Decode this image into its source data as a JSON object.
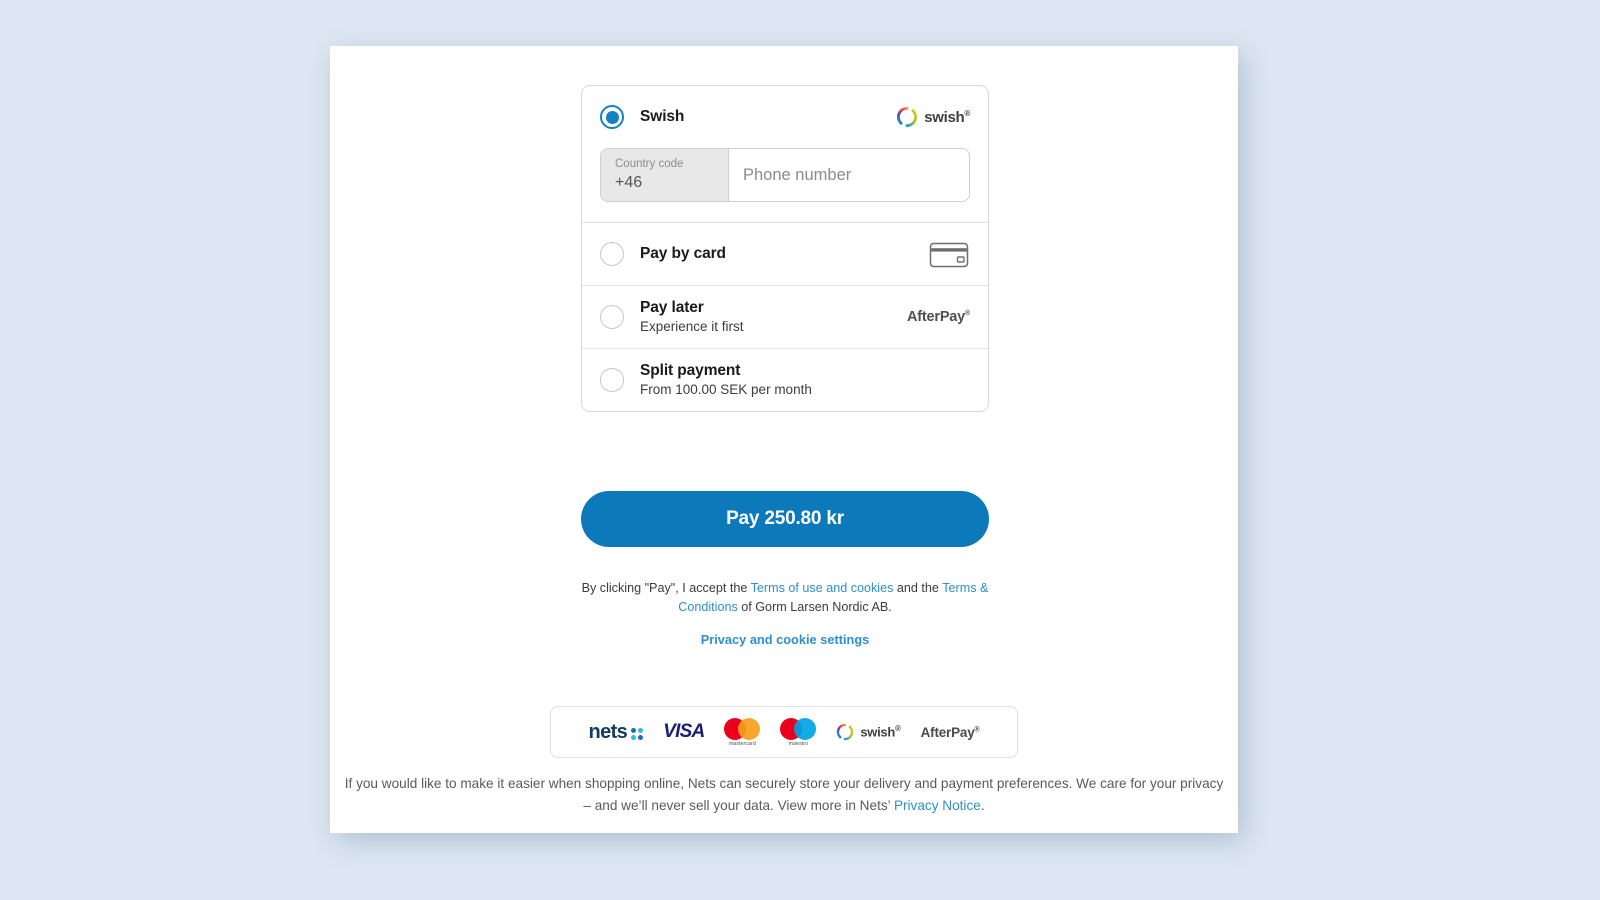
{
  "theme": {
    "background": "#dde7f3",
    "panel": "#ffffff",
    "accent": "#0b79ba",
    "link": "#2f8fcf",
    "radio_selected": "#1680c4",
    "border": "#d8d8d8"
  },
  "methods": [
    {
      "id": "swish",
      "title": "Swish",
      "subtitle": "",
      "selected": true,
      "logo": "swish-logo"
    },
    {
      "id": "card",
      "title": "Pay by card",
      "subtitle": "",
      "selected": false,
      "logo": "credit-card-icon"
    },
    {
      "id": "pay-later",
      "title": "Pay later",
      "subtitle": "Experience it first",
      "selected": false,
      "logo": "afterpay-logo"
    },
    {
      "id": "split-payment",
      "title": "Split payment",
      "subtitle": "From 100.00 SEK per month",
      "selected": false,
      "logo": ""
    }
  ],
  "phone": {
    "country_code_label": "Country code",
    "country_code_value": "+46",
    "number_placeholder": "Phone number"
  },
  "pay": {
    "label": "Pay 250.80 kr",
    "amount": "250.80",
    "currency": "kr"
  },
  "legal": {
    "prefix": "By clicking \"Pay\", I accept the ",
    "link1": "Terms of use and cookies",
    "middle": " and the ",
    "link2": "Terms & Conditions",
    "suffix": " of Gorm Larsen Nordic AB.",
    "privacy_settings": "Privacy and cookie settings"
  },
  "badges": {
    "nets": "nets",
    "visa": "VISA",
    "mastercard": "mastercard",
    "maestro": "maestro",
    "swish": "swish",
    "afterpay": "AfterPay"
  },
  "footer": {
    "text_part1": "If you would like to make it easier when shopping online, Nets can securely store your delivery and payment preferences. We care for your privacy – and we’ll never sell your data. View more in Nets’ ",
    "link": "Privacy Notice",
    "text_part2": "."
  }
}
